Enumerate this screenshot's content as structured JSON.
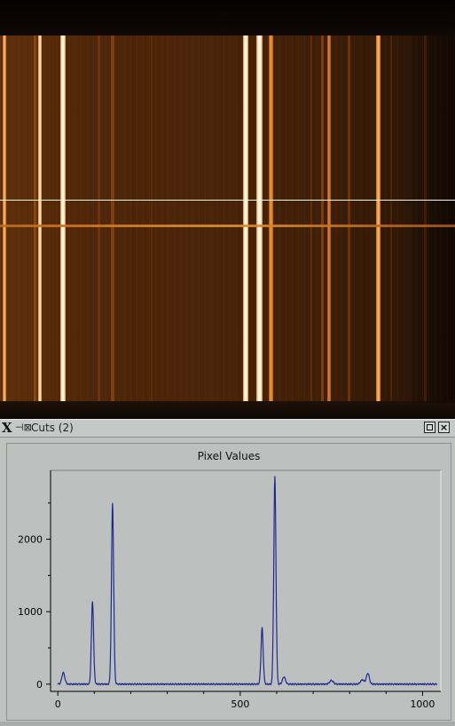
{
  "window": {
    "logo": "X",
    "pin": "⊣⊠",
    "title": "Cuts (2)"
  },
  "plot": {
    "title": "Pixel Values"
  },
  "colors": {
    "line": "#1f2a8c",
    "plot_bg": "#bcc1bf",
    "axis": "#000000"
  },
  "chart_data": {
    "type": "line",
    "title": "Pixel Values",
    "xlabel": "",
    "ylabel": "",
    "xlim": [
      -20,
      1050
    ],
    "ylim": [
      -100,
      2950
    ],
    "x_ticks": [
      "0",
      "500",
      "1000"
    ],
    "y_ticks": [
      "0",
      "1000",
      "2000"
    ],
    "x_tick_values": [
      0,
      500,
      1000
    ],
    "y_tick_values": [
      0,
      1000,
      2000
    ],
    "series": [
      {
        "peaks": [
          {
            "x": 15,
            "y": 160,
            "w": 4
          },
          {
            "x": 95,
            "y": 1150,
            "w": 3
          },
          {
            "x": 150,
            "y": 2500,
            "w": 3
          },
          {
            "x": 560,
            "y": 780,
            "w": 3
          },
          {
            "x": 595,
            "y": 2870,
            "w": 3
          },
          {
            "x": 620,
            "y": 100,
            "w": 4
          },
          {
            "x": 750,
            "y": 50,
            "w": 5
          },
          {
            "x": 850,
            "y": 150,
            "w": 4
          },
          {
            "x": 835,
            "y": 60,
            "w": 5
          }
        ],
        "baseline": 0,
        "x_range": [
          0,
          1040
        ]
      }
    ]
  }
}
